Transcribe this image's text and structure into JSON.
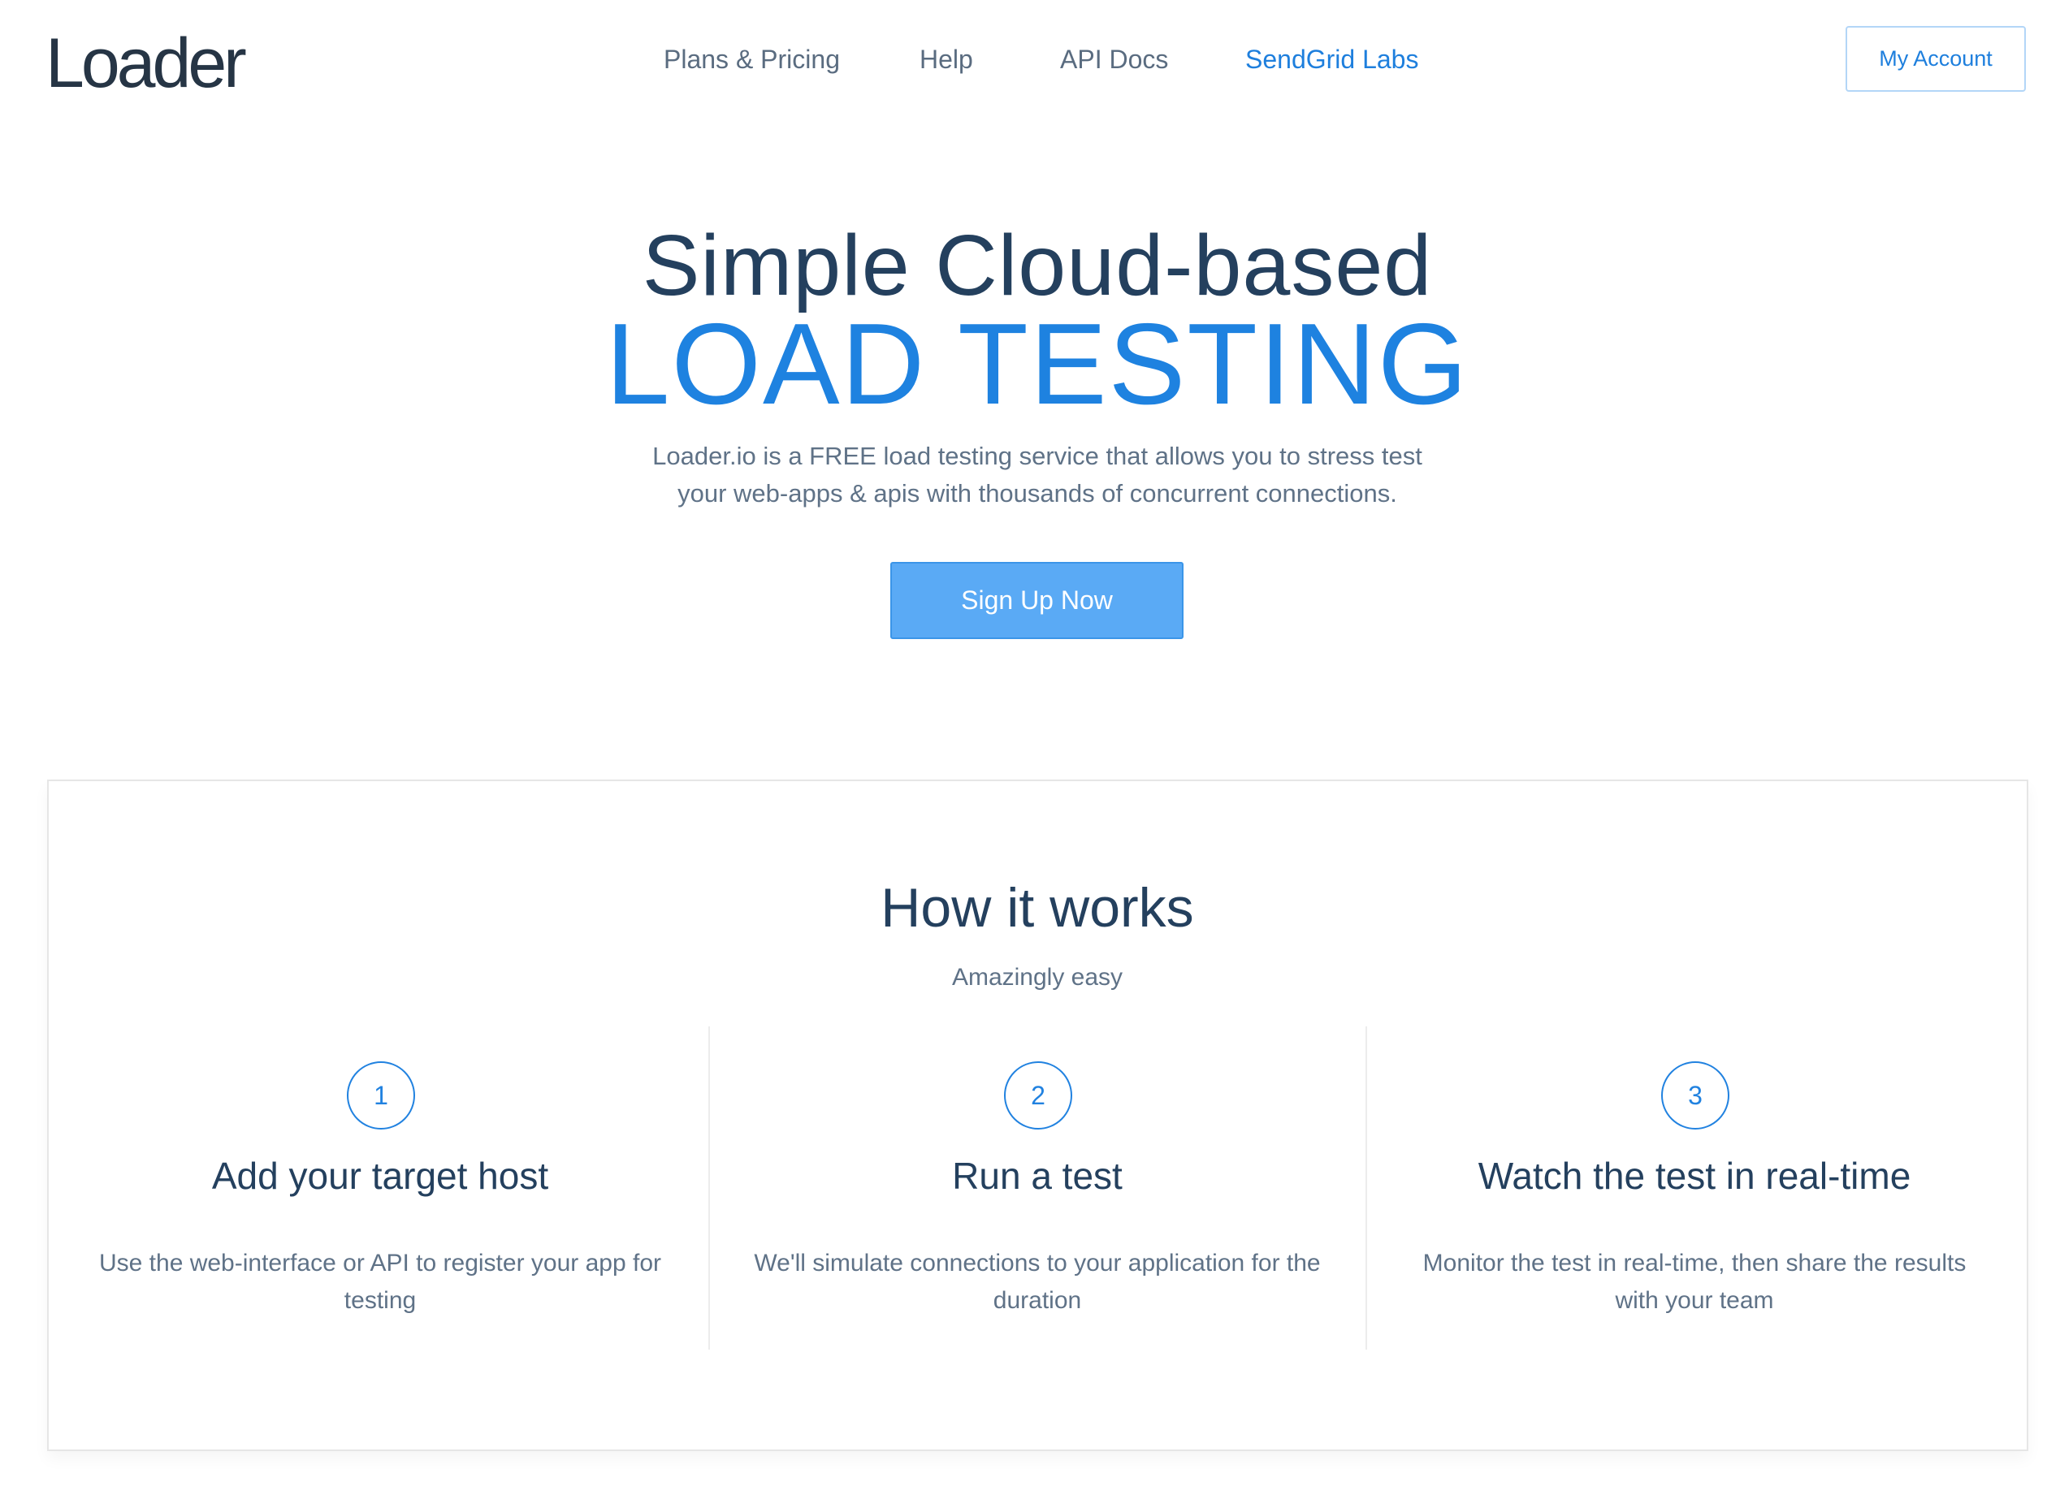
{
  "header": {
    "logo": "Loader",
    "nav": [
      {
        "label": "Plans & Pricing",
        "active": false
      },
      {
        "label": "Help",
        "active": false
      },
      {
        "label": "API Docs",
        "active": false
      },
      {
        "label": "SendGrid Labs",
        "active": true
      }
    ],
    "account_button": "My Account"
  },
  "hero": {
    "title_line1": "Simple Cloud-based",
    "title_line2": "LOAD TESTING",
    "description_line1": "Loader.io is a FREE load testing service that allows you to stress test",
    "description_line2": "your web-apps & apis with thousands of concurrent connections.",
    "cta_label": "Sign Up Now"
  },
  "how_it_works": {
    "title": "How it works",
    "subtitle": "Amazingly easy",
    "steps": [
      {
        "number": "1",
        "title": "Add your target host",
        "description": "Use the web-interface or API to register your app for testing"
      },
      {
        "number": "2",
        "title": "Run a test",
        "description": "We'll simulate connections to your application for the duration"
      },
      {
        "number": "3",
        "title": "Watch the test in real-time",
        "description": "Monitor the test in real-time, then share the results with your team"
      }
    ]
  },
  "colors": {
    "accent": "#1e82e0",
    "button": "#5aaaf5",
    "heading": "#24405e",
    "body_text": "#5f7287",
    "nav_text": "#5a6c80"
  }
}
